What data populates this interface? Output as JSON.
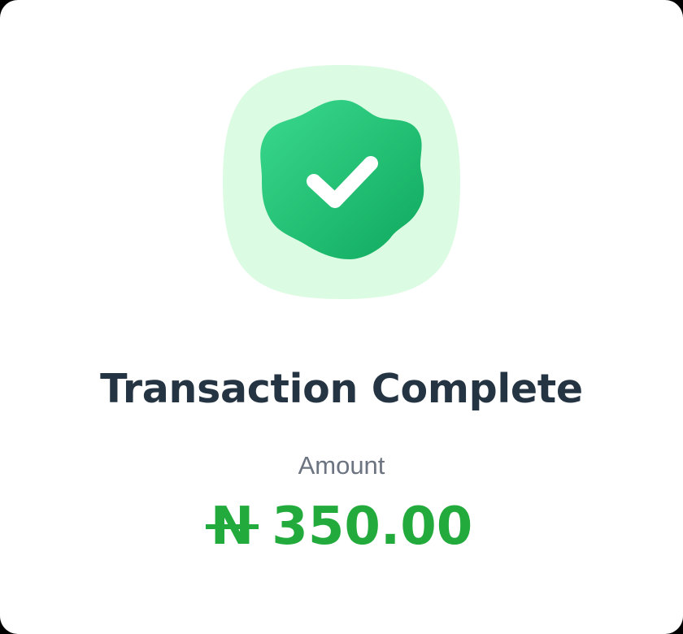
{
  "dialog": {
    "title": "Transaction Complete",
    "amount_label": "Amount",
    "currency_symbol": "N",
    "amount": "350.00",
    "icon": "verified-check-badge-icon"
  },
  "colors": {
    "badge_background": "#dbfbe2",
    "badge_seal_top": "#34d88a",
    "badge_seal_bottom": "#12b065",
    "checkmark": "#ffffff",
    "title": "#253442",
    "label": "#6b7480",
    "amount": "#22ab3c"
  }
}
